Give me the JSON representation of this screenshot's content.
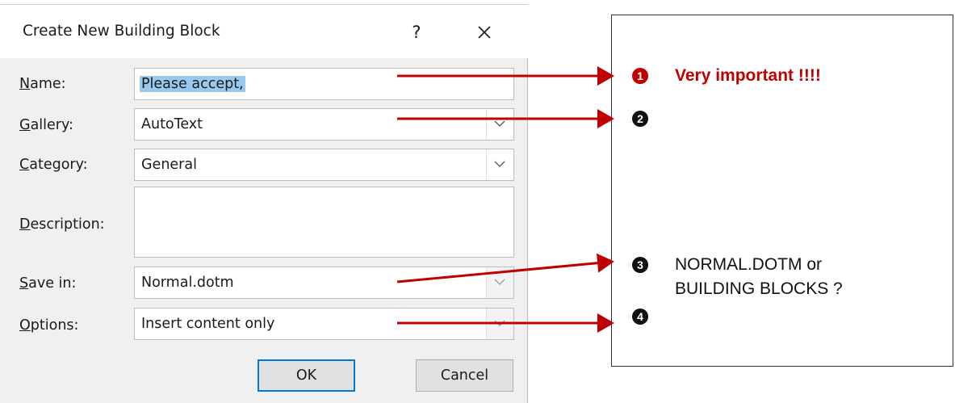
{
  "dialog": {
    "title": "Create New Building Block",
    "help_label": "?",
    "fields": {
      "name": {
        "label_hot": "N",
        "label_rest": "ame:",
        "value": "Please accept,"
      },
      "gallery": {
        "label_hot": "G",
        "label_rest": "allery:",
        "value": "AutoText"
      },
      "category": {
        "label_hot": "C",
        "label_rest": "ategory:",
        "value": "General"
      },
      "description": {
        "label_hot": "D",
        "label_rest": "escription:",
        "value": ""
      },
      "save_in": {
        "label_hot": "S",
        "label_rest": "ave in:",
        "value": "Normal.dotm"
      },
      "options": {
        "label_hot": "O",
        "label_rest": "ptions:",
        "value": "Insert content only"
      }
    },
    "ok_label": "OK",
    "cancel_label": "Cancel"
  },
  "annotation": {
    "notes": [
      {
        "number": "1",
        "text": "Very important  !!!!"
      },
      {
        "number": "2",
        "text": ""
      },
      {
        "number": "3",
        "text_line1": "NORMAL.DOTM or",
        "text_line2": "BUILDING BLOCKS ?"
      },
      {
        "number": "4",
        "text": ""
      }
    ],
    "colors": {
      "arrow": "#c00000",
      "emphasis": "#c00000"
    }
  }
}
